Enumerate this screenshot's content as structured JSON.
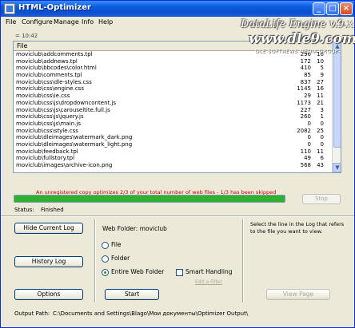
{
  "window": {
    "title": "HTML-Optimizer"
  },
  "menu": [
    "File",
    "Configure",
    "Manage",
    "Info",
    "Help"
  ],
  "watermark": {
    "line1": "DataLife Engine v.9.x",
    "line2": "www.dle9.com",
    "line3": "DLE SOFTNEWS MEDIA GROUP"
  },
  "toolbar": {
    "time": "= 10:42"
  },
  "log": {
    "column_header": "File",
    "rows": [
      [
        "moviclub\\addcomments.tpl",
        "296",
        "16"
      ],
      [
        "moviclub\\addnews.tpl",
        "172",
        "10"
      ],
      [
        "moviclub\\bbcodes\\color.html",
        "410",
        "5"
      ],
      [
        "moviclub\\comments.tpl",
        "85",
        "9"
      ],
      [
        "moviclub\\css\\dle-styles.css",
        "837",
        "27"
      ],
      [
        "moviclub\\css\\engine.css",
        "1145",
        "16"
      ],
      [
        "moviclub\\css\\ie.css",
        "29",
        "11"
      ],
      [
        "moviclub\\css\\js\\dropdowncontent.js",
        "1173",
        "21"
      ],
      [
        "moviclub\\css\\js\\carouseltite.full.js",
        "227",
        "3"
      ],
      [
        "moviclub\\css\\js\\jquery.js",
        "260",
        "1"
      ],
      [
        "moviclub\\css\\js\\main.js",
        "0",
        "0"
      ],
      [
        "moviclub\\css\\style.css",
        "2082",
        "25"
      ],
      [
        "moviclub\\dleimages\\watermark_dark.png",
        "0",
        "0"
      ],
      [
        "moviclub\\dleimages\\watermark_light.png",
        "0",
        "0"
      ],
      [
        "moviclub\\feedback.tpl",
        "110",
        "11"
      ],
      [
        "moviclub\\fullstory.tpl",
        "49",
        "6"
      ],
      [
        "moviclub\\images\\archive-icon.png",
        "568",
        "43"
      ]
    ]
  },
  "warning_text": "An unregistered copy optimizes 2/3 of your total number of web files - 1/3 has been skipped",
  "progress": {
    "value": 1.0,
    "color": "#2fb12f"
  },
  "stop_label": "Stop",
  "status": {
    "label": "Status:",
    "value": "Finished"
  },
  "buttons": {
    "hide_log": "Hide Current Log",
    "history_log": "History Log",
    "options": "Options",
    "start": "Start",
    "view_page": "View Page"
  },
  "web_folder_label": "Web Folder: moviclub",
  "radios": {
    "file": "File",
    "folder": "Folder",
    "entire": "Entire Web Folder",
    "selected": "entire"
  },
  "smart_handling": "Smart Handling",
  "edit_filter": "Edit a Filter",
  "hint": "Select the line in the Log that refers to the file you want to view.",
  "output": {
    "label": "Output Path:",
    "value": "C:\\Documents and Settings\\Blago\\Мои документы\\Optimizer Output\\"
  }
}
